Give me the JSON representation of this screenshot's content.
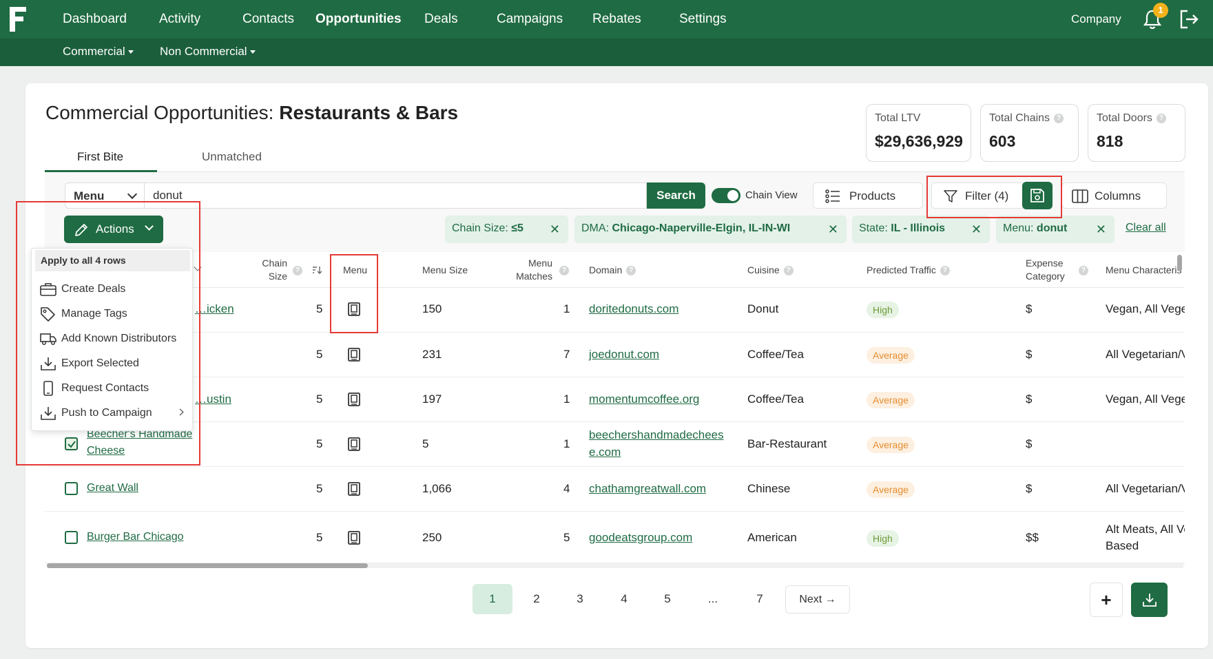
{
  "nav": {
    "items": [
      "Dashboard",
      "Activity",
      "Contacts",
      "Opportunities",
      "Deals",
      "Campaigns",
      "Rebates",
      "Settings"
    ],
    "active": "Opportunities",
    "sub_items": [
      "Commercial",
      "Non Commercial"
    ],
    "company": "Company",
    "notification_count": "1"
  },
  "page": {
    "title_prefix": "Commercial Opportunities: ",
    "title_bold": "Restaurants & Bars"
  },
  "stats": [
    {
      "label": "Total LTV",
      "value": "$29,636,929"
    },
    {
      "label": "Total Chains",
      "value": "603"
    },
    {
      "label": "Total Doors",
      "value": "818"
    }
  ],
  "tabs": [
    "First Bite",
    "Unmatched"
  ],
  "search": {
    "field": "Menu",
    "value": "donut",
    "button": "Search",
    "chain_view": "Chain View",
    "products": "Products",
    "filter": "Filter (4)",
    "columns": "Columns"
  },
  "actions": {
    "button": "Actions",
    "menu_header": "Apply to all 4 rows",
    "items": [
      "Create Deals",
      "Manage Tags",
      "Add Known Distributors",
      "Export Selected",
      "Request Contacts",
      "Push to Campaign"
    ]
  },
  "filters": [
    {
      "key": "Chain Size: ",
      "value": "≤5"
    },
    {
      "key": "DMA: ",
      "value": "Chicago-Naperville-Elgin, IL-IN-WI"
    },
    {
      "key": "State: ",
      "value": "IL - Illinois"
    },
    {
      "key": "Menu: ",
      "value": "donut"
    }
  ],
  "clear_all": "Clear all",
  "table": {
    "headers": {
      "chain_size_1": "Chain",
      "chain_size_2": "Size",
      "menu": "Menu",
      "menu_size": "Menu Size",
      "menu_matches_1": "Menu",
      "menu_matches_2": "Matches",
      "domain": "Domain",
      "cuisine": "Cuisine",
      "traffic": "Predicted Traffic",
      "expense_1": "Expense",
      "expense_2": "Category",
      "menu_char": "Menu Characteris"
    },
    "rows": [
      {
        "name": "…icken",
        "chain_size": "5",
        "menu_size": "150",
        "matches": "1",
        "domain": "doritedonuts.com",
        "cuisine": "Donut",
        "traffic": "High",
        "expense": "$",
        "menu_char": "Vegan, All Vege"
      },
      {
        "name": "",
        "chain_size": "5",
        "menu_size": "231",
        "matches": "7",
        "domain": "joedonut.com",
        "cuisine": "Coffee/Tea",
        "traffic": "Average",
        "expense": "$",
        "menu_char": "All Vegetarian/V"
      },
      {
        "name": "…ustin",
        "chain_size": "5",
        "menu_size": "197",
        "matches": "1",
        "domain": "momentumcoffee.org",
        "cuisine": "Coffee/Tea",
        "traffic": "Average",
        "expense": "$",
        "menu_char": "Vegan, All Vege"
      },
      {
        "name_1": "Beecher's Handmade",
        "name_2": "Cheese",
        "chain_size": "5",
        "menu_size": "5",
        "matches": "1",
        "domain_1": "beechershandmadechees",
        "domain_2": "e.com",
        "cuisine": "Bar-Restaurant",
        "traffic": "Average",
        "expense": "$",
        "menu_char": ""
      },
      {
        "name": "Great Wall",
        "chain_size": "5",
        "menu_size": "1,066",
        "matches": "4",
        "domain": "chathamgreatwall.com",
        "cuisine": "Chinese",
        "traffic": "Average",
        "expense": "$",
        "menu_char": "All Vegetarian/V"
      },
      {
        "name": "Burger Bar Chicago",
        "chain_size": "5",
        "menu_size": "250",
        "matches": "5",
        "domain": "goodeatsgroup.com",
        "cuisine": "American",
        "traffic": "High",
        "expense": "$$",
        "menu_char_1": "Alt Meats, All Ve",
        "menu_char_2": "Based"
      }
    ]
  },
  "pagination": {
    "pages": [
      "1",
      "2",
      "3",
      "4",
      "5",
      "...",
      "7"
    ],
    "active": "1",
    "next": "Next"
  },
  "colors": {
    "brand_green": "#1f6b43",
    "annotation_red": "#e53935",
    "traffic_high": "#6e9b38",
    "traffic_average": "#e58d2f"
  }
}
